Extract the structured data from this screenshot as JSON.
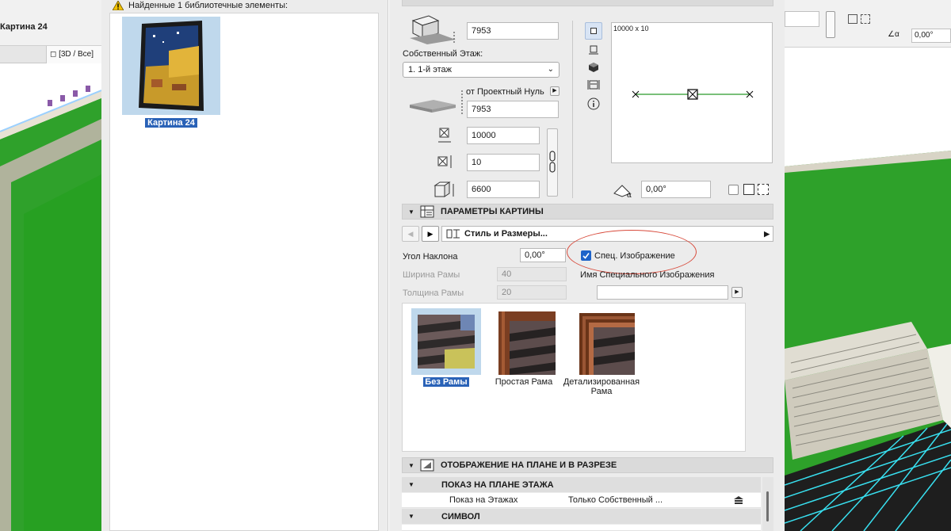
{
  "viewport": {
    "left_title": "Картина 24",
    "tab_3d": "[3D / Все]",
    "angle_value": "0,00°"
  },
  "library": {
    "found_label": "Найденные 1 библиотечные элементы:",
    "item_label": "Картина 24"
  },
  "placement": {
    "elevation_value": "7953",
    "home_story_label": "Собственный Этаж:",
    "home_story_value": "1. 1-й этаж",
    "project_zero_label": "от Проектный Нуль",
    "project_zero_value": "7953",
    "width_value": "10000",
    "depth_value": "10",
    "height_value": "6600",
    "preview_dim": "10000 x 10",
    "rotation_value": "0,00°"
  },
  "picture_params": {
    "section_title": "ПАРАМЕТРЫ КАРТИНЫ",
    "style_label": "Стиль и Размеры...",
    "tilt_label": "Угол Наклона",
    "tilt_value": "0,00°",
    "custom_image_label": "Спец. Изображение",
    "custom_image_checked": true,
    "frame_width_label": "Ширина Рамы",
    "frame_width_value": "40",
    "frame_thickness_label": "Толщина Рамы",
    "frame_thickness_value": "20",
    "custom_image_name_label": "Имя Специального Изображения",
    "custom_image_name_value": "",
    "frames": [
      {
        "label": "Без Рамы",
        "selected": true
      },
      {
        "label": "Простая Рама",
        "selected": false
      },
      {
        "label": "Детализированная Рама",
        "selected": false
      }
    ]
  },
  "plan_section": {
    "section_title": "ОТОБРАЖЕНИЕ НА ПЛАНЕ И В РАЗРЕЗЕ",
    "floor_plan_head": "ПОКАЗ НА ПЛАНЕ ЭТАЖА",
    "show_on_stories_label": "Показ на Этажах",
    "show_on_stories_value": "Только Собственный ...",
    "symbol_head": "СИМВОЛ"
  },
  "colors": {
    "accent": "#2a62b7",
    "annotation_circle": "#d84a3b",
    "wall_green": "#2ea12a",
    "floor_cyan": "#38e0f0"
  }
}
